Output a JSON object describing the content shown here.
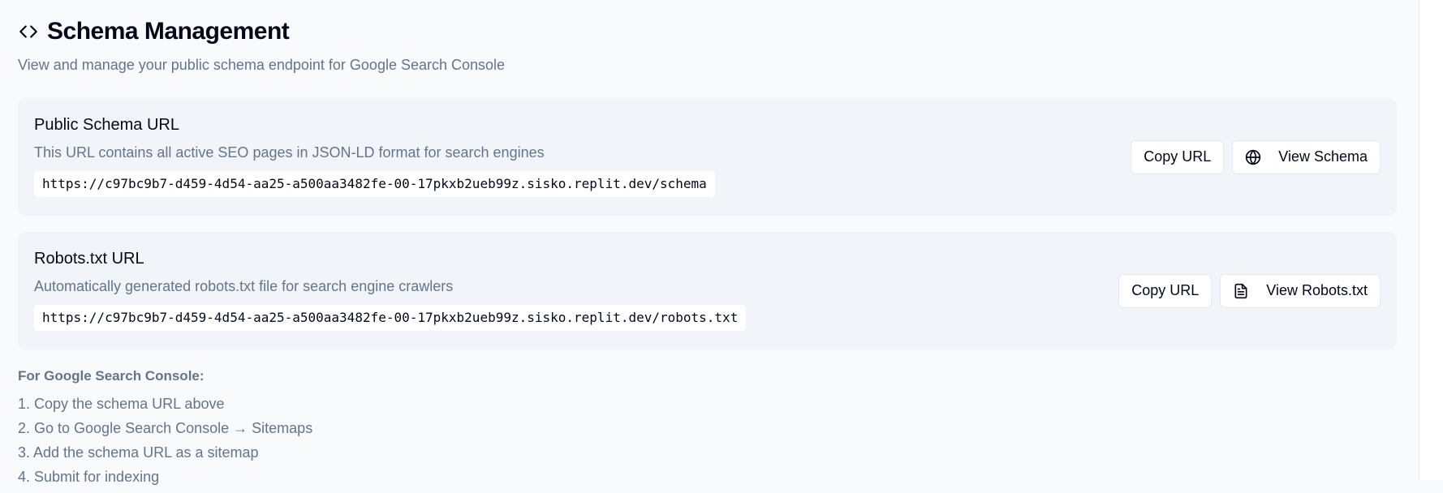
{
  "header": {
    "icon": "code-icon",
    "title": "Schema Management",
    "subtitle": "View and manage your public schema endpoint for Google Search Console"
  },
  "schema_card": {
    "title": "Public Schema URL",
    "description": "This URL contains all active SEO pages in JSON-LD format for search engines",
    "url": "https://c97bc9b7-d459-4d54-aa25-a500aa3482fe-00-17pkxb2ueb99z.sisko.replit.dev/schema",
    "copy_label": "Copy URL",
    "view_label": "View Schema",
    "view_icon": "globe-icon"
  },
  "robots_card": {
    "title": "Robots.txt URL",
    "description": "Automatically generated robots.txt file for search engine crawlers",
    "url": "https://c97bc9b7-d459-4d54-aa25-a500aa3482fe-00-17pkxb2ueb99z.sisko.replit.dev/robots.txt",
    "copy_label": "Copy URL",
    "view_label": "View Robots.txt",
    "view_icon": "file-text-icon"
  },
  "instructions": {
    "heading": "For Google Search Console:",
    "steps": [
      "1. Copy the schema URL above",
      "2. Go to Google Search Console → Sitemaps",
      "3. Add the schema URL as a sitemap",
      "4. Submit for indexing"
    ]
  },
  "colors": {
    "background": "#f9fafb",
    "card_background": "#f1f5f9",
    "muted_text": "#64748b",
    "primary_text": "#020817",
    "border": "#e2e8f0"
  }
}
